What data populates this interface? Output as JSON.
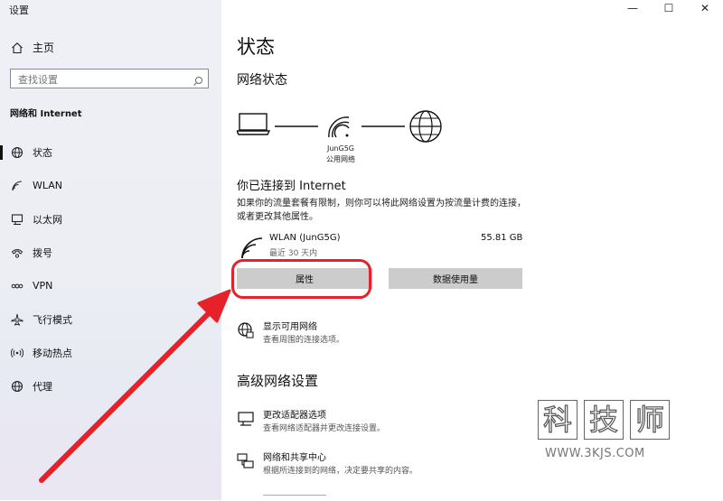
{
  "window": {
    "title": "设置",
    "controls": {
      "minimize": "—",
      "maximize": "☐",
      "close": "✕"
    }
  },
  "sidebar": {
    "home_label": "主页",
    "home_icon": "home-icon",
    "search_placeholder": "查找设置",
    "search_icon": "search-icon",
    "section_label": "网络和 Internet",
    "items": [
      {
        "label": "状态",
        "icon": "globe-status-icon",
        "active": true
      },
      {
        "label": "WLAN",
        "icon": "wifi-icon",
        "active": false
      },
      {
        "label": "以太网",
        "icon": "ethernet-icon",
        "active": false
      },
      {
        "label": "拨号",
        "icon": "dialup-icon",
        "active": false
      },
      {
        "label": "VPN",
        "icon": "vpn-icon",
        "active": false
      },
      {
        "label": "飞行模式",
        "icon": "airplane-icon",
        "active": false
      },
      {
        "label": "移动热点",
        "icon": "hotspot-icon",
        "active": false
      },
      {
        "label": "代理",
        "icon": "globe-icon",
        "active": false
      }
    ]
  },
  "main": {
    "title": "状态",
    "network_status_heading": "网络状态",
    "network": {
      "name": "JunG5G",
      "type": "公用网络"
    },
    "connected_title": "你已连接到 Internet",
    "connected_desc": "如果你的流量套餐有限制，则你可以将此网络设置为按流量计费的连接，或者更改其他属性。",
    "connection": {
      "name": "WLAN (JunG5G)",
      "period": "最近 30 天内",
      "usage": "55.81 GB"
    },
    "buttons": {
      "properties": "属性",
      "data_usage": "数据使用量"
    },
    "show_networks": {
      "title": "显示可用网络",
      "desc": "查看周围的连接选项。"
    },
    "advanced_heading": "高级网络设置",
    "advanced_items": [
      {
        "title": "更改适配器选项",
        "desc": "查看网络适配器并更改连接设置。"
      },
      {
        "title": "网络和共享中心",
        "desc": "根据所连接到的网络，决定要共享的内容。"
      }
    ]
  },
  "annotation": {
    "color": "#e52229"
  },
  "watermark": {
    "chars": [
      "科",
      "技",
      "师"
    ],
    "url": "WWW.3KJS.COM"
  }
}
